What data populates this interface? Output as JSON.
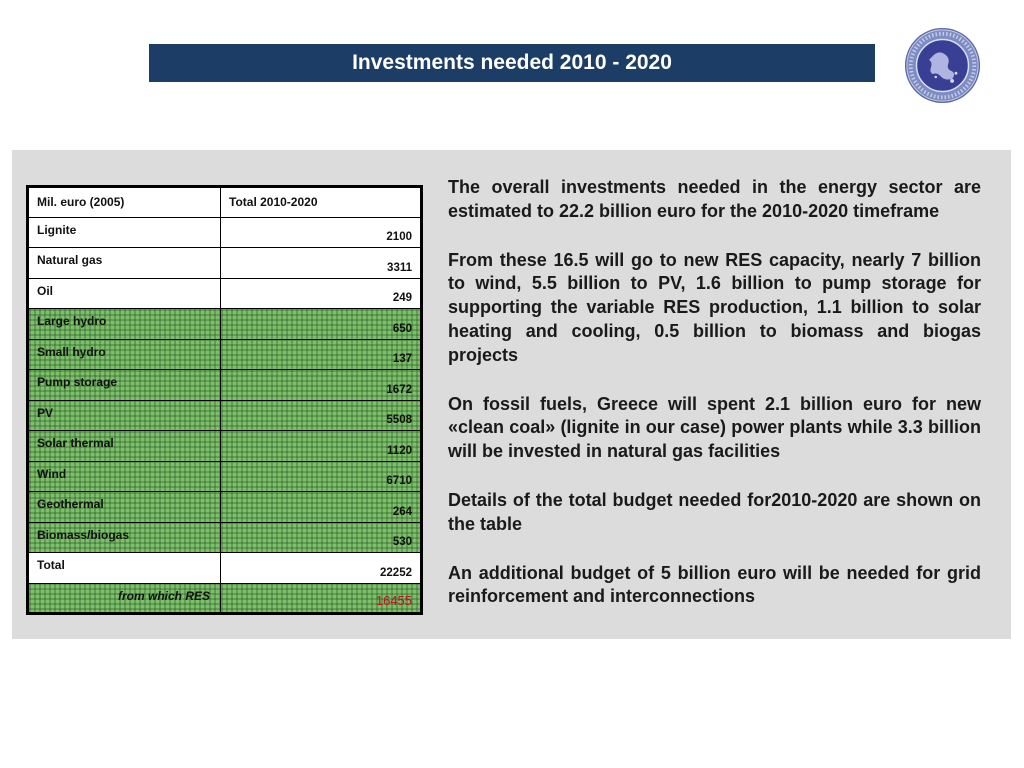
{
  "header": {
    "title": "Investments needed 2010 - 2020"
  },
  "logo": {
    "icon": "greek-energy-seal-logo",
    "text": "ΕΛΛΗΝΙΚΗ ΕΠΙΣΤΗΜΟΝΙΚΗ ΕΝΩΣΗ ΗΛΙΑΚΗΣ ΕΝΕΡΓΕΙΑΣ"
  },
  "table": {
    "header": [
      "Mil. euro (2005)",
      "Total 2010-2020"
    ],
    "rows": [
      {
        "label": "Lignite",
        "value": "2100"
      },
      {
        "label": "Natural gas",
        "value": "3311"
      },
      {
        "label": "Oil",
        "value": "249"
      },
      {
        "label": "Large hydro",
        "value": "650"
      },
      {
        "label": "Small hydro",
        "value": "137"
      },
      {
        "label": "Pump storage",
        "value": "1672"
      },
      {
        "label": "PV",
        "value": "5508"
      },
      {
        "label": "Solar thermal",
        "value": "1120"
      },
      {
        "label": "Wind",
        "value": "6710"
      },
      {
        "label": "Geothermal",
        "value": "264"
      },
      {
        "label": "Biomass/biogas",
        "value": "530"
      },
      {
        "label": "Total",
        "value": "22252"
      },
      {
        "label": "from which RES",
        "value": "16455"
      }
    ],
    "colors": {
      "res_fill": "#7ebf6c",
      "res_value": "#c0101a"
    }
  },
  "paragraphs": [
    "The overall investments needed in the energy sector are estimated to 22.2 billion euro for the 2010-2020 timeframe",
    "From these 16.5 will go to new RES capacity, nearly 7 billion to wind, 5.5 billion to PV, 1.6 billion to pump storage for supporting the variable RES production, 1.1 billion to solar heating and cooling, 0.5 billion to biomass and biogas projects",
    "On fossil fuels, Greece will spent 2.1 billion euro for new «clean coal» (lignite in our case) power plants while 3.3 billion will be invested in natural gas facilities",
    "Details of the total budget needed for2010-2020 are shown on the table",
    "An additional budget of 5 billion euro will be needed for grid reinforcement and interconnections"
  ],
  "colors": {
    "title_bar": "#1c3d66",
    "panel": "#dcdcdc"
  }
}
